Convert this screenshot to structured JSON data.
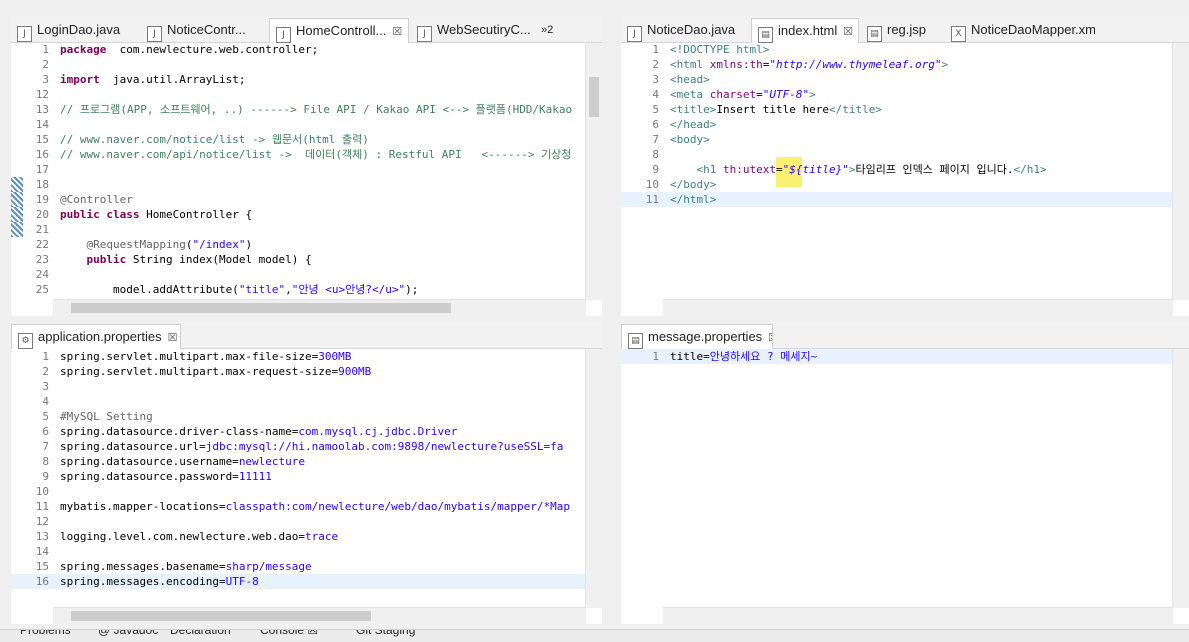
{
  "top_left": {
    "tabs": [
      {
        "label": "LoginDao.java",
        "icon": "J"
      },
      {
        "label": "NoticeContr...",
        "icon": "J"
      },
      {
        "label": "HomeControll...",
        "icon": "J",
        "close": "☒"
      },
      {
        "label": "WebSecutiryC...",
        "icon": "J"
      }
    ],
    "overflow": "»2",
    "lines": [
      {
        "n": "1",
        "segs": [
          [
            "kw",
            "package"
          ],
          [
            "",
            "  com.newlecture.web.controller;"
          ]
        ]
      },
      {
        "n": "2",
        "segs": []
      },
      {
        "n": "3",
        "segs": [
          [
            "kw",
            "import"
          ],
          [
            "",
            "  java.util.ArrayList;"
          ]
        ]
      },
      {
        "n": "12",
        "segs": []
      },
      {
        "n": "13",
        "segs": [
          [
            "cmt",
            "// 프로그램(APP, 소프트웨어, ..) ------> File API / Kakao API <--> 플랫폼(HDD/Kakao"
          ]
        ]
      },
      {
        "n": "14",
        "segs": []
      },
      {
        "n": "15",
        "segs": [
          [
            "cmt",
            "// www.naver.com/notice/list -> 웹문서(html 출력)"
          ]
        ]
      },
      {
        "n": "16",
        "segs": [
          [
            "cmt",
            "// www.naver.com/api/notice/list ->  데이터(객체) : Restful API   <------> 기상청"
          ]
        ]
      },
      {
        "n": "17",
        "segs": []
      },
      {
        "n": "18",
        "segs": []
      },
      {
        "n": "19",
        "segs": [
          [
            "ann",
            "@Controller"
          ]
        ]
      },
      {
        "n": "20",
        "segs": [
          [
            "kw",
            "public class"
          ],
          [
            "",
            " HomeController {"
          ]
        ]
      },
      {
        "n": "21",
        "segs": []
      },
      {
        "n": "22",
        "segs": [
          [
            "ann",
            "    @RequestMapping"
          ],
          [
            "",
            "("
          ],
          [
            "str",
            "\"/index\""
          ],
          [
            "",
            ")"
          ]
        ]
      },
      {
        "n": "23",
        "segs": [
          [
            "kw",
            "    public"
          ],
          [
            "",
            " String index(Model model) {"
          ]
        ]
      },
      {
        "n": "24",
        "segs": []
      },
      {
        "n": "25",
        "segs": [
          [
            "",
            "        model.addAttribute("
          ],
          [
            "str",
            "\"title\""
          ],
          [
            "",
            ","
          ],
          [
            "str",
            "\"안녕 <u>안녕?</u>\""
          ],
          [
            "",
            ");"
          ]
        ]
      }
    ]
  },
  "top_right": {
    "tabs": [
      {
        "label": "NoticeDao.java",
        "icon": "J"
      },
      {
        "label": "index.html",
        "icon": "▤",
        "close": "☒"
      },
      {
        "label": "reg.jsp",
        "icon": "▤"
      },
      {
        "label": "NoticeDaoMapper.xml",
        "icon": "X"
      }
    ],
    "lines": [
      {
        "n": "1",
        "segs": [
          [
            "tag",
            "<!DOCTYPE html>"
          ]
        ]
      },
      {
        "n": "2",
        "segs": [
          [
            "tag",
            "<html "
          ],
          [
            "attr",
            "xmlns:th"
          ],
          [
            "",
            "="
          ],
          [
            "aval",
            "\"http://www.thymeleaf.org\""
          ],
          [
            "tag",
            ">"
          ]
        ]
      },
      {
        "n": "3",
        "segs": [
          [
            "tag",
            "<head>"
          ]
        ]
      },
      {
        "n": "4",
        "segs": [
          [
            "tag",
            "<meta "
          ],
          [
            "attr",
            "charset"
          ],
          [
            "",
            "="
          ],
          [
            "aval",
            "\"UTF-8\""
          ],
          [
            "tag",
            ">"
          ]
        ]
      },
      {
        "n": "5",
        "segs": [
          [
            "tag",
            "<title>"
          ],
          [
            "",
            "Insert title here"
          ],
          [
            "tag",
            "</title>"
          ]
        ]
      },
      {
        "n": "6",
        "segs": [
          [
            "tag",
            "</head>"
          ]
        ]
      },
      {
        "n": "7",
        "segs": [
          [
            "tag",
            "<body>"
          ]
        ]
      },
      {
        "n": "8",
        "segs": []
      },
      {
        "n": "9",
        "segs": [
          [
            "tag",
            "    <h1 "
          ],
          [
            "attr",
            "th:utext"
          ],
          [
            "",
            "="
          ],
          [
            "aval",
            "\"${title}\""
          ],
          [
            "tag",
            ">"
          ],
          [
            "",
            "타임리프 인덱스 페이지 입니다."
          ],
          [
            "tag",
            "</h1>"
          ]
        ]
      },
      {
        "n": "10",
        "segs": [
          [
            "tag",
            "</body>"
          ]
        ]
      },
      {
        "n": "11",
        "segs": [
          [
            "tag",
            "</html>"
          ]
        ]
      }
    ]
  },
  "bottom_left": {
    "tabs": [
      {
        "label": "application.properties",
        "icon": "⚙",
        "close": "☒"
      }
    ],
    "lines": [
      {
        "n": "1",
        "segs": [
          [
            "pkey",
            "spring.servlet.multipart.max-file-size="
          ],
          [
            "pval",
            "300MB"
          ]
        ]
      },
      {
        "n": "2",
        "segs": [
          [
            "pkey",
            "spring.servlet.multipart.max-request-size="
          ],
          [
            "pval",
            "900MB"
          ]
        ]
      },
      {
        "n": "3",
        "segs": []
      },
      {
        "n": "4",
        "segs": []
      },
      {
        "n": "5",
        "segs": [
          [
            "ann",
            "#MySQL Setting"
          ]
        ]
      },
      {
        "n": "6",
        "segs": [
          [
            "pkey",
            "spring.datasource.driver-class-name="
          ],
          [
            "pval",
            "com.mysql.cj.jdbc.Driver"
          ]
        ]
      },
      {
        "n": "7",
        "segs": [
          [
            "pkey",
            "spring.datasource.url="
          ],
          [
            "pval",
            "jdbc:mysql://hi.namoolab.com:9898/newlecture?useSSL=fa"
          ]
        ]
      },
      {
        "n": "8",
        "segs": [
          [
            "pkey",
            "spring.datasource.username="
          ],
          [
            "pval",
            "newlecture"
          ]
        ]
      },
      {
        "n": "9",
        "segs": [
          [
            "pkey",
            "spring.datasource.password="
          ],
          [
            "pval",
            "11111"
          ]
        ]
      },
      {
        "n": "10",
        "segs": []
      },
      {
        "n": "11",
        "segs": [
          [
            "pkey",
            "mybatis.mapper-locations="
          ],
          [
            "pval",
            "classpath:com/newlecture/web/dao/mybatis/mapper/*Map"
          ]
        ]
      },
      {
        "n": "12",
        "segs": []
      },
      {
        "n": "13",
        "segs": [
          [
            "pkey",
            "logging.level.com.newlecture.web.dao="
          ],
          [
            "pval",
            "trace"
          ]
        ]
      },
      {
        "n": "14",
        "segs": []
      },
      {
        "n": "15",
        "segs": [
          [
            "pkey",
            "spring.messages.basename="
          ],
          [
            "pval",
            "sharp/message"
          ]
        ]
      },
      {
        "n": "16",
        "segs": [
          [
            "pkey",
            "spring.messages.encoding="
          ],
          [
            "pval",
            "UTF-8"
          ]
        ]
      }
    ]
  },
  "bottom_right": {
    "tabs": [
      {
        "label": "message.properties",
        "icon": "▤",
        "close": "☒"
      }
    ],
    "lines": [
      {
        "n": "1",
        "segs": [
          [
            "pkey",
            "title="
          ],
          [
            "pval",
            "안녕하세요 ? 메세지~"
          ]
        ]
      }
    ]
  },
  "bottom_panel": {
    "tabs": [
      "Problems",
      "@ Javadoc",
      "Declaration",
      "Console ☒",
      "Git Staging"
    ]
  }
}
